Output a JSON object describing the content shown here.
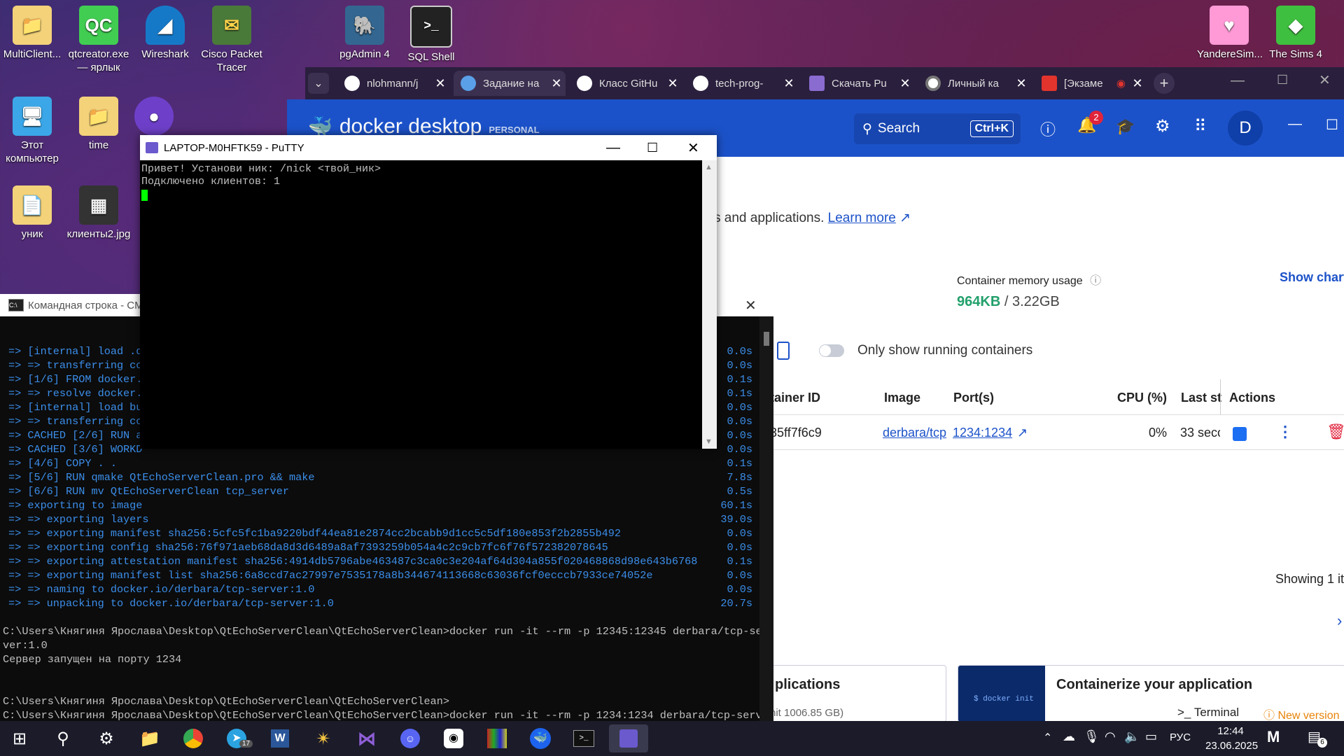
{
  "desktop_icons": [
    {
      "label": "MultiClient...",
      "icon": "folder-doc-icon"
    },
    {
      "label": "qtcreator.exe — ярлык",
      "icon": "qtcreator-icon"
    },
    {
      "label": "Wireshark",
      "icon": "wireshark-icon"
    },
    {
      "label": "Cisco Packet Tracer",
      "icon": "packet-tracer-icon"
    },
    {
      "label": "pgAdmin 4",
      "icon": "pgadmin-icon"
    },
    {
      "label": "SQL Shell",
      "icon": "sql-shell-icon"
    },
    {
      "label": "Этот компьютер",
      "icon": "computer-icon"
    },
    {
      "label": "time",
      "icon": "folder-icon"
    },
    {
      "label": "уник",
      "icon": "folder-doc-icon"
    },
    {
      "label": "клиенты2.jpg",
      "icon": "image-file-icon"
    },
    {
      "label": "YandereSim...",
      "icon": "heart-icon"
    },
    {
      "label": "The Sims 4",
      "icon": "sims-icon"
    }
  ],
  "browser": {
    "tabs": [
      {
        "label": "nlohmann/j",
        "icon": "github-icon"
      },
      {
        "label": "Задание на",
        "icon": "task-icon",
        "active": true
      },
      {
        "label": "Класс GitHu",
        "icon": "github-icon"
      },
      {
        "label": "tech-prog-",
        "icon": "github-icon"
      },
      {
        "label": "Скачать Pu",
        "icon": "putty-icon"
      },
      {
        "label": "Личный ка",
        "icon": "account-icon"
      },
      {
        "label": "[Экзаме",
        "icon": "exam-icon"
      }
    ]
  },
  "docker": {
    "brand": "docker desktop",
    "plan": "PERSONAL",
    "search_label": "Search",
    "search_shortcut": "Ctrl+K",
    "notification_count": "2",
    "avatar_letter": "D",
    "intro_text": "s and applications.",
    "learn_more": "Learn more",
    "memory_label": "Container memory usage",
    "memory_used": "964KB",
    "memory_total": "/ 3.22GB",
    "show_charts": "Show charts",
    "toggle_label": "Only show running containers",
    "columns": [
      "tainer ID",
      "Image",
      "Port(s)",
      "CPU (%)",
      "Last st",
      "Actions"
    ],
    "row": {
      "id": "35ff7f6c9",
      "image": "derbara/tcp",
      "ports": "1234:1234",
      "cpu": "0%",
      "last": "33 seco"
    },
    "showing": "Showing 1 it",
    "card1_title": "plications",
    "card2_title": "Containerize your application",
    "card2_code": "$ docker init",
    "footer_limit": "nit 1006.85 GB)",
    "terminal_label": "Terminal",
    "new_version": "New version"
  },
  "putty": {
    "title": "LAPTOP-M0HFTK59 - PuTTY",
    "lines": [
      "Привет! Установи ник: /nick <твой_ник>",
      "Подключено клиентов: 1"
    ]
  },
  "cmd": {
    "title": "Командная строка - CM",
    "build_lines": [
      {
        "t": "=> [internal] load .d",
        "time": "0.0s"
      },
      {
        "t": "=> => transferring co",
        "time": "0.0s"
      },
      {
        "t": "=> [1/6] FROM docker.",
        "time": "0.1s"
      },
      {
        "t": "=> => resolve docker.",
        "time": "0.1s"
      },
      {
        "t": "=> [internal] load bu",
        "time": "0.0s"
      },
      {
        "t": "=> => transferring co",
        "time": "0.0s"
      },
      {
        "t": "=> CACHED [2/6] RUN a",
        "time": "0.0s"
      },
      {
        "t": "=> CACHED [3/6] WORKD",
        "time": "0.0s"
      },
      {
        "t": "=> [4/6] COPY . .",
        "time": "0.1s"
      },
      {
        "t": "=> [5/6] RUN qmake QtEchoServerClean.pro && make",
        "time": "7.8s"
      },
      {
        "t": "=> [6/6] RUN mv QtEchoServerClean tcp_server",
        "time": "0.5s"
      },
      {
        "t": "=> exporting to image",
        "time": "60.1s"
      },
      {
        "t": "=> => exporting layers",
        "time": "39.0s"
      },
      {
        "t": "=> => exporting manifest sha256:5cfc5fc1ba9220bdf44ea81e2874cc2bcabb9d1cc5c5df180e853f2b2855b492",
        "time": "0.0s"
      },
      {
        "t": "=> => exporting config sha256:76f971aeb68da8d3d6489a8af7393259b054a4c2c9cb7fc6f76f572382078645",
        "time": "0.0s"
      },
      {
        "t": "=> => exporting attestation manifest sha256:4914db5796abe463487c3ca0c3e204af64d304a855f020468868d98e643b6768",
        "time": "0.1s"
      },
      {
        "t": "=> => exporting manifest list sha256:6a8ccd7ac27997e7535178a8b344674113668c63036fcf0ecccb7933ce74052e",
        "time": "0.0s"
      },
      {
        "t": "=> => naming to docker.io/derbara/tcp-server:1.0",
        "time": "0.0s"
      },
      {
        "t": "=> => unpacking to docker.io/derbara/tcp-server:1.0",
        "time": "20.7s"
      }
    ],
    "output_lines": [
      "",
      "C:\\Users\\Княгиня Ярослава\\Desktop\\QtEchoServerClean\\QtEchoServerClean>docker run -it --rm -p 12345:12345 derbara/tcp-ser",
      "ver:1.0",
      "Сервер запущен на порту 1234",
      "",
      "",
      "C:\\Users\\Княгиня Ярослава\\Desktop\\QtEchoServerClean\\QtEchoServerClean>",
      "C:\\Users\\Княгиня Ярослава\\Desktop\\QtEchoServerClean\\QtEchoServerClean>docker run -it --rm -p 1234:1234 derbara/tcp-serve",
      "r:1.0",
      "Сервер запущен на порту 1234"
    ]
  },
  "taskbar": {
    "lang": "РУС",
    "time": "12:44",
    "date": "23.06.2025",
    "telegram_badge": "17",
    "notif_badge": "6"
  }
}
